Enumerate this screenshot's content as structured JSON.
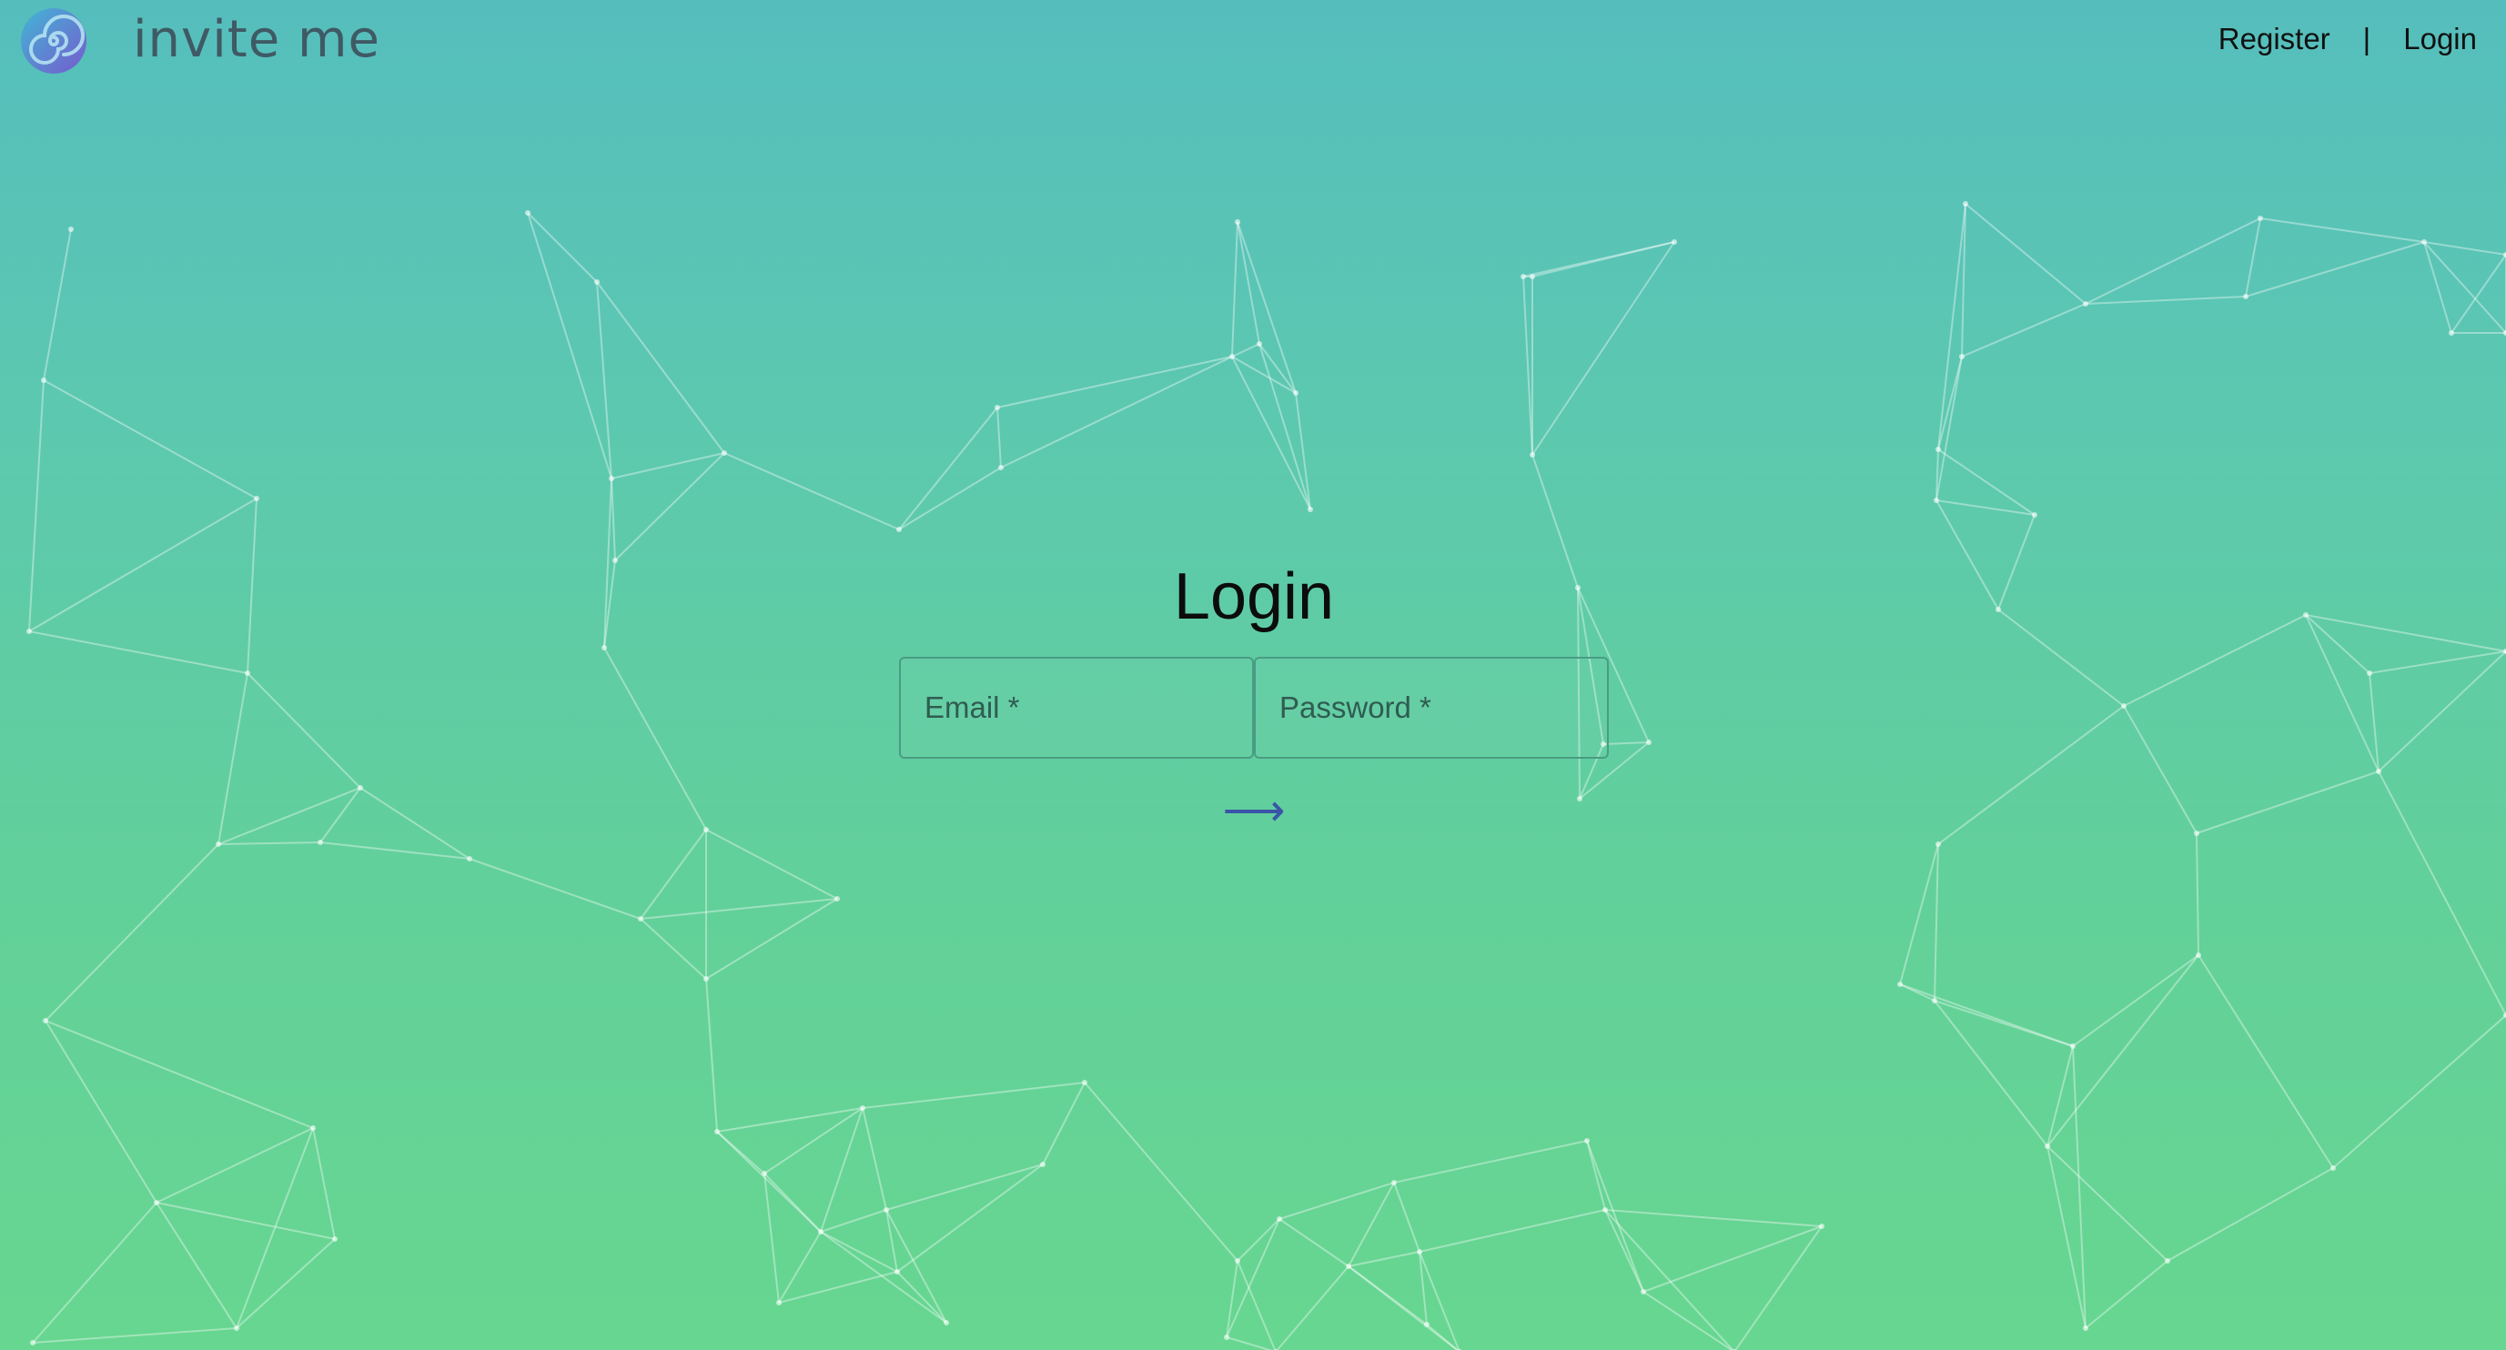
{
  "header": {
    "brand_name": "invite me",
    "nav": {
      "register_label": "Register",
      "separator": "|",
      "login_label": "Login"
    }
  },
  "login_form": {
    "title": "Login",
    "email_placeholder": "Email *",
    "password_placeholder": "Password *",
    "submit_icon": "arrow-right-icon",
    "submit_glyph": "⟶"
  },
  "colors": {
    "background_top": "#55bebd",
    "background_bottom": "#67d690",
    "brand_text": "#3f5a64",
    "submit_arrow": "#3a55a8"
  },
  "icons": {
    "logo": "spiral-logo-icon"
  }
}
